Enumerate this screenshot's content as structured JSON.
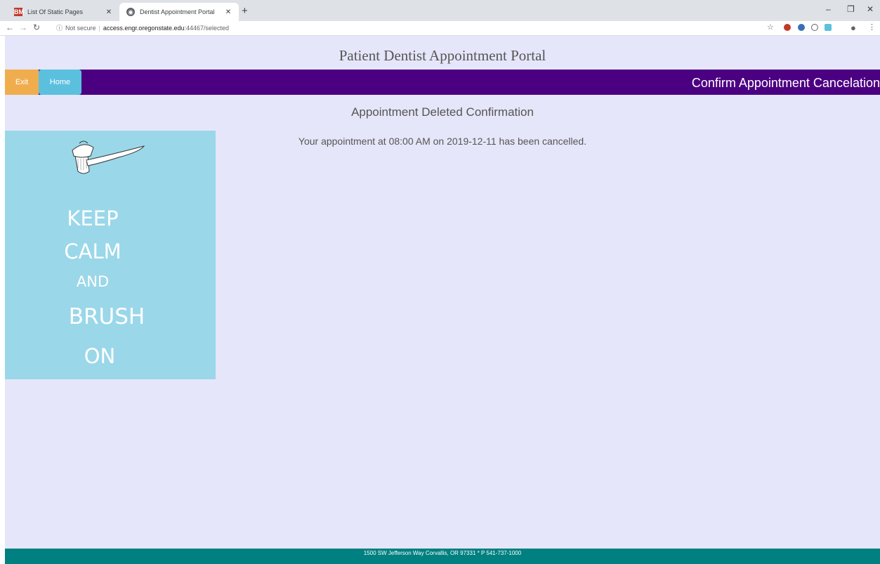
{
  "browser": {
    "tabs": [
      {
        "title": "List Of Static Pages",
        "favicon_text": "BM",
        "active": false
      },
      {
        "title": "Dentist Appointment Portal",
        "active": true
      }
    ],
    "url": {
      "security": "Not secure",
      "host": "access.engr.oregonstate.edu",
      "rest": ":44467/selected"
    }
  },
  "site": {
    "title": "Patient Dentist Appointment Portal",
    "nav": {
      "exit_label": "Exit",
      "home_label": "Home",
      "page_title": "Confirm Appointment Cancelation"
    },
    "heading": "Appointment Deleted Confirmation",
    "message": "Your appointment at 08:00 AM on 2019-12-11 has been cancelled.",
    "poster": {
      "line1": "KEEP",
      "line2": "CALM",
      "line3": "AND",
      "line4": "BRUSH",
      "line5": "ON"
    },
    "footer": "1500 SW Jefferson Way Corvallis, OR 97331 * P 541-737-1000"
  },
  "colors": {
    "page_bg": "#e6e6fa",
    "navbar": "#4b0082",
    "exit_button": "#f0ad4e",
    "home_button": "#5bc0de",
    "poster_bg": "#9ad7e9",
    "footer": "#008080"
  }
}
